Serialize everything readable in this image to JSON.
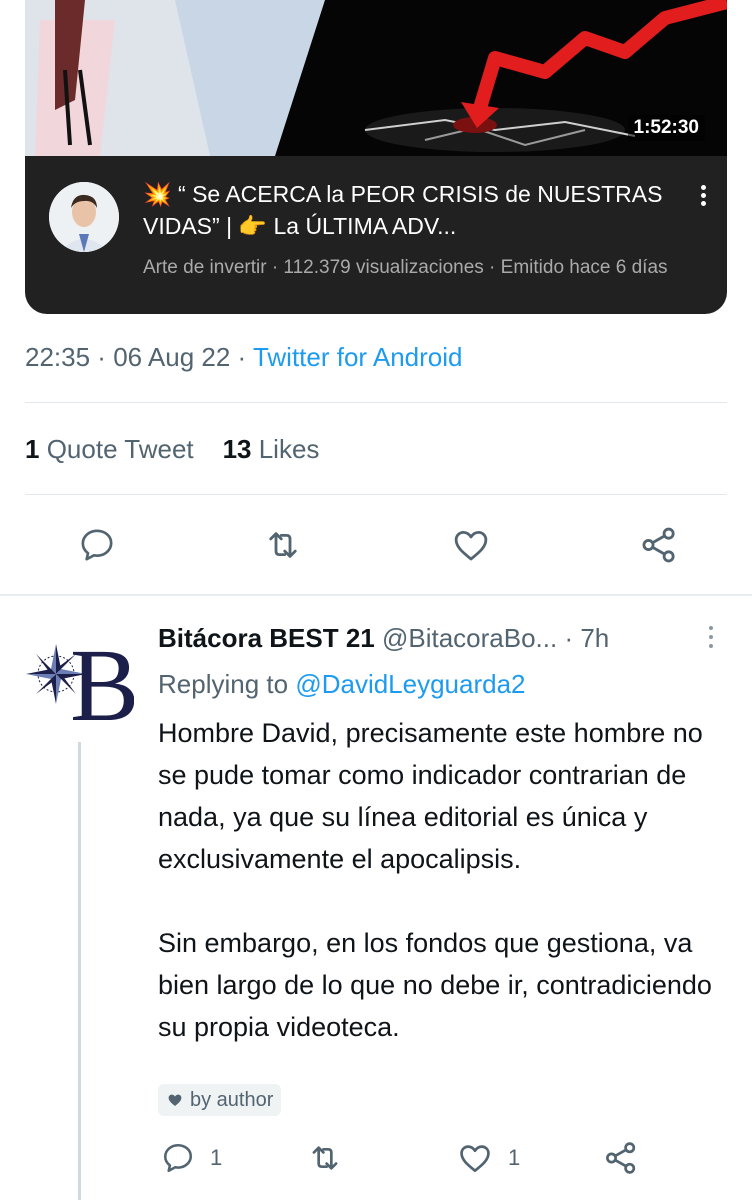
{
  "video_card": {
    "duration": "1:52:30",
    "title_emoji_1": "💥",
    "title_line": "“ Se ACERCA la PEOR CRISIS de NUESTRAS VIDAS” | 👉 La ÚLTIMA ADV...",
    "meta": "Arte de invertir · 112.379 visualizaciones · Emitido hace 6 días"
  },
  "tweet": {
    "time": "22:35",
    "date": "06 Aug 22",
    "source": "Twitter for Android",
    "quote_count": "1",
    "quote_label": "Quote Tweet",
    "likes_count": "13",
    "likes_label": "Likes"
  },
  "reply": {
    "name": "Bitácora BEST 21",
    "handle": "@BitacoraBo...",
    "time": "· 7h",
    "replying_prefix": "Replying to",
    "replying_to": "@DavidLeyguarda2",
    "text_p1": "Hombre David, precisamente este hombre no se pude tomar como indicador contrarian de nada, ya que su línea editorial es única y exclusivamente el apocalipsis.",
    "text_p2": "Sin embargo, en los fondos que gestiona, va bien largo de lo que no debe ir, contradiciendo su propia videoteca.",
    "badge": "by author",
    "reply_count": "1",
    "like_count": "1"
  },
  "colors": {
    "accent": "#1d9bf0",
    "muted": "#536471",
    "card_bg": "#212121",
    "logo_navy": "#1c1f4a"
  }
}
